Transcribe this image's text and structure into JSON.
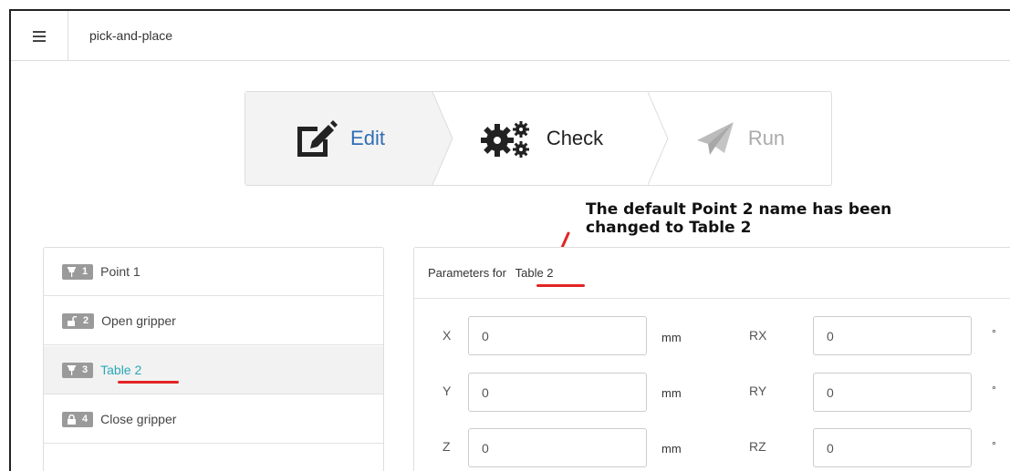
{
  "app": {
    "title": "pick-and-place"
  },
  "stepper": {
    "edit_label": "Edit",
    "check_label": "Check",
    "run_label": "Run"
  },
  "annotation": {
    "line1": "The default Point 2 name has been",
    "line2": "changed to Table 2"
  },
  "program": {
    "items": [
      {
        "number": "1",
        "icon": "pin-icon",
        "label": "Point 1"
      },
      {
        "number": "2",
        "icon": "unlock-icon",
        "label": "Open gripper"
      },
      {
        "number": "3",
        "icon": "pin-icon",
        "label": "Table 2"
      },
      {
        "number": "4",
        "icon": "lock-icon",
        "label": "Close gripper"
      }
    ]
  },
  "parameters": {
    "header_prefix": "Parameters for",
    "name": "Table 2",
    "fields": {
      "x": {
        "label": "X",
        "value": "0",
        "unit": "mm"
      },
      "y": {
        "label": "Y",
        "value": "0",
        "unit": "mm"
      },
      "z": {
        "label": "Z",
        "value": "0",
        "unit": "mm"
      },
      "rx": {
        "label": "RX",
        "value": "0",
        "unit": "°"
      },
      "ry": {
        "label": "RY",
        "value": "0",
        "unit": "°"
      },
      "rz": {
        "label": "RZ",
        "value": "0",
        "unit": "°"
      }
    }
  },
  "colors": {
    "accent": "#2f6db5",
    "link": "#2aa8b8",
    "annotation_red": "#e32424",
    "badge": "#9a9a9a"
  }
}
